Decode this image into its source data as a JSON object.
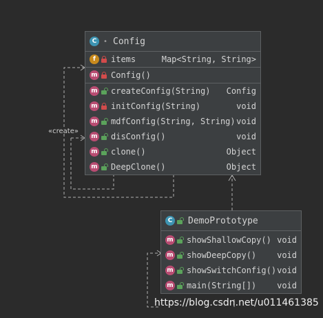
{
  "config": {
    "title": "Config",
    "field": {
      "name": "items",
      "type": "Map<String, String>"
    },
    "constructor": {
      "name": "Config()"
    },
    "methods": [
      {
        "name": "createConfig(String)",
        "type": "Config",
        "access": "public"
      },
      {
        "name": "initConfig(String)",
        "type": "void",
        "access": "private"
      },
      {
        "name": "mdfConfig(String, String)",
        "type": "void",
        "access": "public"
      },
      {
        "name": "disConfig()",
        "type": "void",
        "access": "public"
      },
      {
        "name": "clone()",
        "type": "Object",
        "access": "public"
      },
      {
        "name": "DeepClone()",
        "type": "Object",
        "access": "public"
      }
    ]
  },
  "demo": {
    "title": "DemoPrototype",
    "methods": [
      {
        "name": "showShallowCopy()",
        "type": "void"
      },
      {
        "name": "showDeepCopy()",
        "type": "void"
      },
      {
        "name": "showSwitchConfig()",
        "type": "void"
      },
      {
        "name": "main(String[])",
        "type": "void"
      }
    ]
  },
  "relations": {
    "create_label": "«create»"
  },
  "watermark": "https://blog.csdn.net/u011461385",
  "icons": {
    "class": "C",
    "field": "f",
    "method": "m"
  },
  "colors": {
    "background": "#2b2b2b",
    "box": "#3c3f41",
    "border": "#5e6163",
    "text": "#d4d4d4"
  }
}
